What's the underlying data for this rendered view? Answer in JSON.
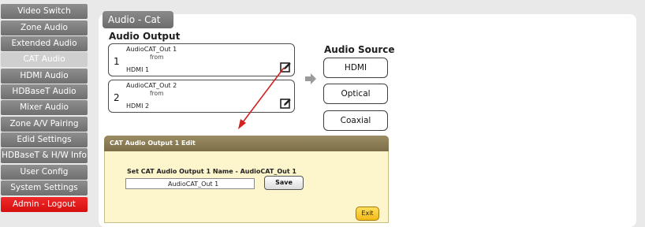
{
  "sidebar": {
    "items": [
      {
        "label": "Video Switch"
      },
      {
        "label": "Zone Audio"
      },
      {
        "label": "Extended Audio"
      },
      {
        "label": "CAT Audio"
      },
      {
        "label": "HDMI Audio"
      },
      {
        "label": "HDBaseT Audio"
      },
      {
        "label": "Mixer Audio"
      },
      {
        "label": "Zone A/V Pairing"
      },
      {
        "label": "Edid Settings"
      },
      {
        "label": "HDBaseT & H/W Info"
      },
      {
        "label": "User Config"
      },
      {
        "label": "System Settings"
      },
      {
        "label": "Admin - Logout"
      }
    ],
    "active_item": "CAT Audio"
  },
  "page": {
    "tab_title": "Audio - Cat"
  },
  "audio_output": {
    "heading": "Audio Output",
    "outputs": [
      {
        "number": "1",
        "name": "AudioCAT_Out 1",
        "from_label": "from",
        "source": "HDMI 1"
      },
      {
        "number": "2",
        "name": "AudioCAT_Out 2",
        "from_label": "from",
        "source": "HDMI 2"
      }
    ]
  },
  "audio_source": {
    "heading": "Audio Source",
    "options": [
      {
        "label": "HDMI"
      },
      {
        "label": "Optical"
      },
      {
        "label": "Coaxial"
      }
    ]
  },
  "dialog": {
    "title": "CAT Audio Output 1 Edit",
    "label": "Set CAT Audio Output 1 Name - AudioCAT_Out 1",
    "name_value": "AudioCAT_Out 1",
    "save_label": "Save",
    "exit_label": "Exit"
  },
  "colors": {
    "sidebar_bg": "#7f7f7f",
    "sidebar_active": "#cfcfcf",
    "logout_red": "#e51b1b",
    "dialog_bg": "#fdf5cc",
    "dialog_header": "#8c7d55",
    "exit_yellow": "#f7c933",
    "pointer_arrow": "#d22020"
  },
  "icons": {
    "edit": "pencil-edit-icon",
    "direction": "right-arrow-icon"
  }
}
